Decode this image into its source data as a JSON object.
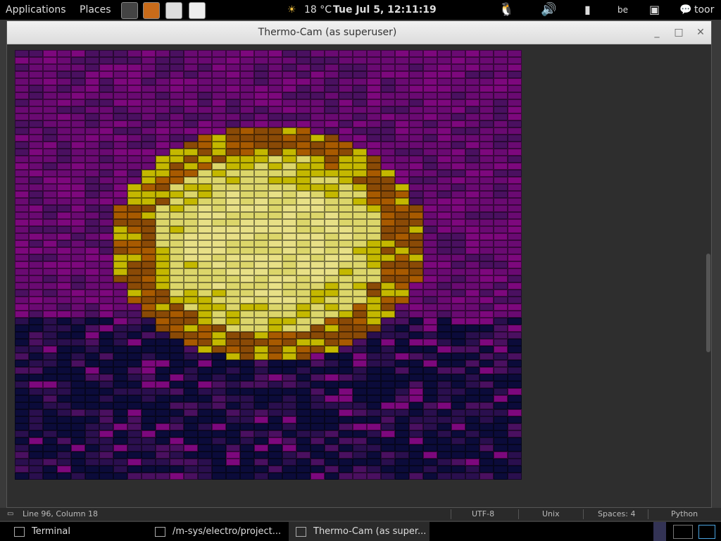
{
  "top_panel": {
    "applications": "Applications",
    "places": "Places",
    "weather": "18 °C",
    "clock": "Tue Jul  5, 12:11:19",
    "keyboard": "be",
    "user": "toor"
  },
  "window": {
    "title": "Thermo-Cam (as superuser)"
  },
  "thermal": {
    "cols": 36,
    "rows": 61,
    "hot_cols": [
      7,
      28
    ],
    "hot_rows": [
      11,
      43
    ],
    "palette": [
      "#0b0b3a",
      "#2a0f4e",
      "#4a1060",
      "#6a0a72",
      "#7d087d",
      "#8a4a06",
      "#a85a00",
      "#c4b800",
      "#dcd66a",
      "#e8e086"
    ]
  },
  "statusbar": {
    "position": "Line 96, Column 18",
    "encoding": "UTF-8",
    "line_endings": "Unix",
    "indent": "Spaces: 4",
    "language": "Python"
  },
  "taskbar": {
    "items": [
      {
        "label": "Terminal"
      },
      {
        "label": "/m-sys/electro/project..."
      },
      {
        "label": "Thermo-Cam (as super..."
      }
    ]
  }
}
